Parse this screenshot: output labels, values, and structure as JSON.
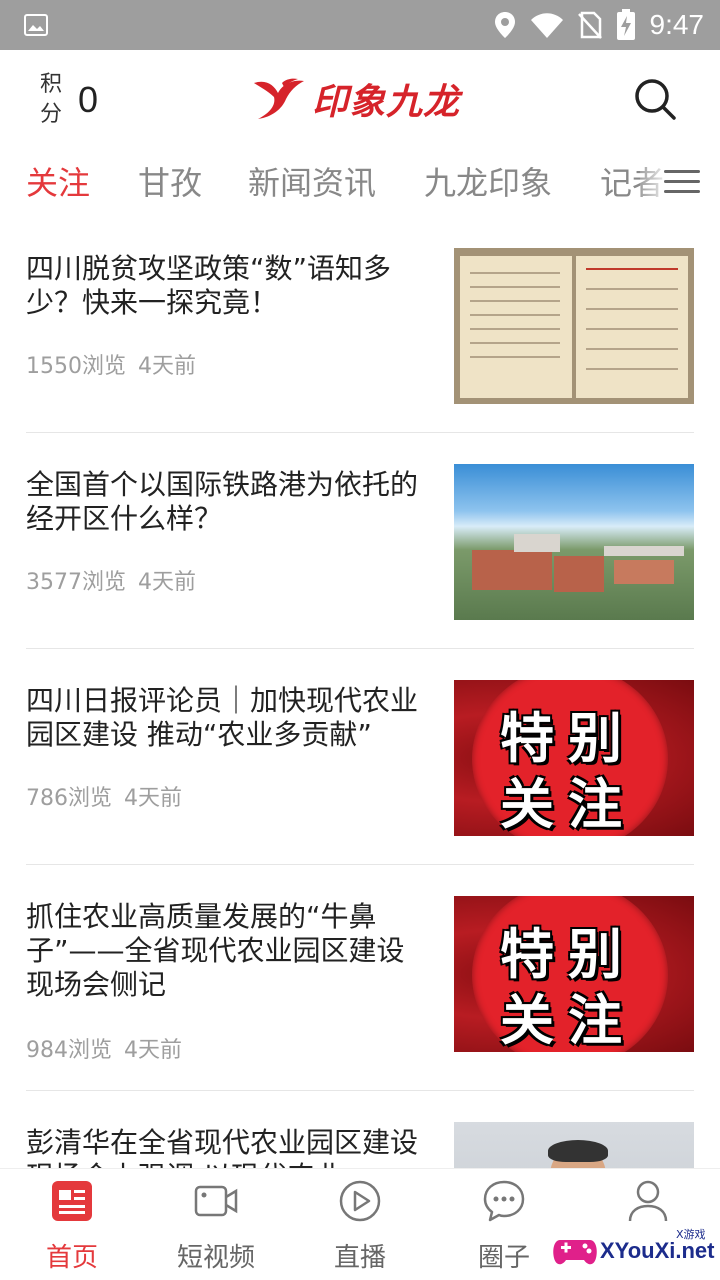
{
  "status_bar": {
    "time": "9:47",
    "icons": [
      "image-icon",
      "location-icon",
      "wifi-icon",
      "no-sim-icon",
      "battery-charging-icon"
    ]
  },
  "header": {
    "points_label": "积分",
    "points_value": "0",
    "app_name": "印象九龙",
    "brand_color": "#d6232a"
  },
  "tabs": [
    {
      "label": "关注",
      "active": true
    },
    {
      "label": "甘孜",
      "active": false
    },
    {
      "label": "新闻资讯",
      "active": false
    },
    {
      "label": "九龙印象",
      "active": false
    },
    {
      "label": "记者",
      "active": false
    }
  ],
  "articles": [
    {
      "title": "四川脱贫攻坚政策“数”语知多少？快来一探究竟！",
      "views": "1550浏览",
      "time": "4天前",
      "thumb": "book-pages"
    },
    {
      "title": "全国首个以国际铁路港为依托的经开区什么样？",
      "views": "3577浏览",
      "time": "4天前",
      "thumb": "aerial-city"
    },
    {
      "title": "四川日报评论员｜加快现代农业园区建设 推动“农业多贡献”",
      "views": "786浏览",
      "time": "4天前",
      "thumb": "special-attention"
    },
    {
      "title": "抓住农业高质量发展的“牛鼻子”——全省现代农业园区建设现场会侧记",
      "views": "984浏览",
      "time": "4天前",
      "thumb": "special-attention"
    },
    {
      "title": "彭清华在全省现代农业园区建设现场会上强调 以现代农业",
      "views": "",
      "time": "",
      "thumb": "portrait"
    }
  ],
  "special_thumb": {
    "line1": "特别",
    "line2": "关注"
  },
  "bottom_nav": [
    {
      "label": "首页",
      "icon": "news-icon",
      "active": true
    },
    {
      "label": "短视频",
      "icon": "video-camera-icon",
      "active": false
    },
    {
      "label": "直播",
      "icon": "play-circle-icon",
      "active": false
    },
    {
      "label": "圈子",
      "icon": "chat-bubble-icon",
      "active": false
    },
    {
      "label": "",
      "icon": "user-icon",
      "active": false
    }
  ],
  "watermark": {
    "text": "XYouXi.net",
    "small": "X游戏"
  },
  "colors": {
    "accent": "#e4393c",
    "muted": "#9e9e9e",
    "statusbar": "#9e9e9e"
  }
}
